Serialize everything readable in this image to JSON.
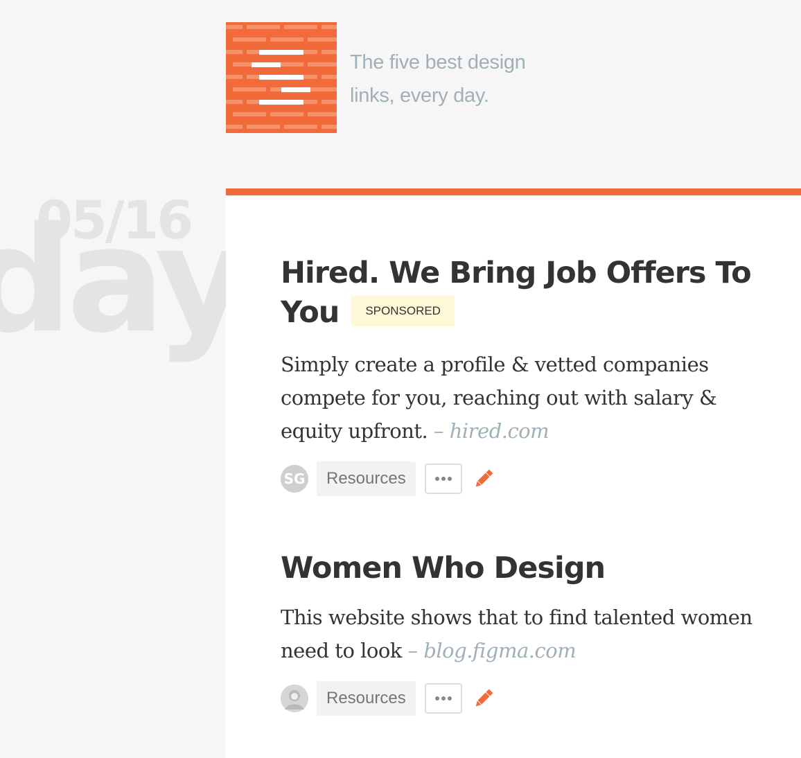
{
  "header": {
    "tagline_line1": "The five best design",
    "tagline_line2": "links, every day."
  },
  "date": {
    "day_word": "day",
    "number": "05/16"
  },
  "posts": [
    {
      "title": "Hired. We Bring Job Offers To",
      "title_line2": "You",
      "badge": "SPONSORED",
      "desc_lines": [
        "Simply create a profile & vetted companies",
        "compete for you, reaching out with salary &",
        "equity upfront."
      ],
      "source": "– hired.com",
      "avatar_icon": "sg-logo-avatar",
      "tag": "Resources",
      "more_icon": "ellipsis-icon",
      "edit_icon": "pencil-icon"
    },
    {
      "title": "Women Who Design",
      "desc_lines": [
        "This website shows that to find talented women",
        "need to look"
      ],
      "source": "– blog.figma.com",
      "avatar_icon": "user-photo-avatar",
      "tag": "Resources",
      "more_icon": "ellipsis-icon",
      "edit_icon": "pencil-icon"
    }
  ],
  "colors": {
    "accent": "#f06a3a",
    "background": "#f6f6f6",
    "card": "#ffffff",
    "text": "#333333",
    "muted": "#9fb0b8",
    "badge_bg": "#fdf8d6"
  }
}
